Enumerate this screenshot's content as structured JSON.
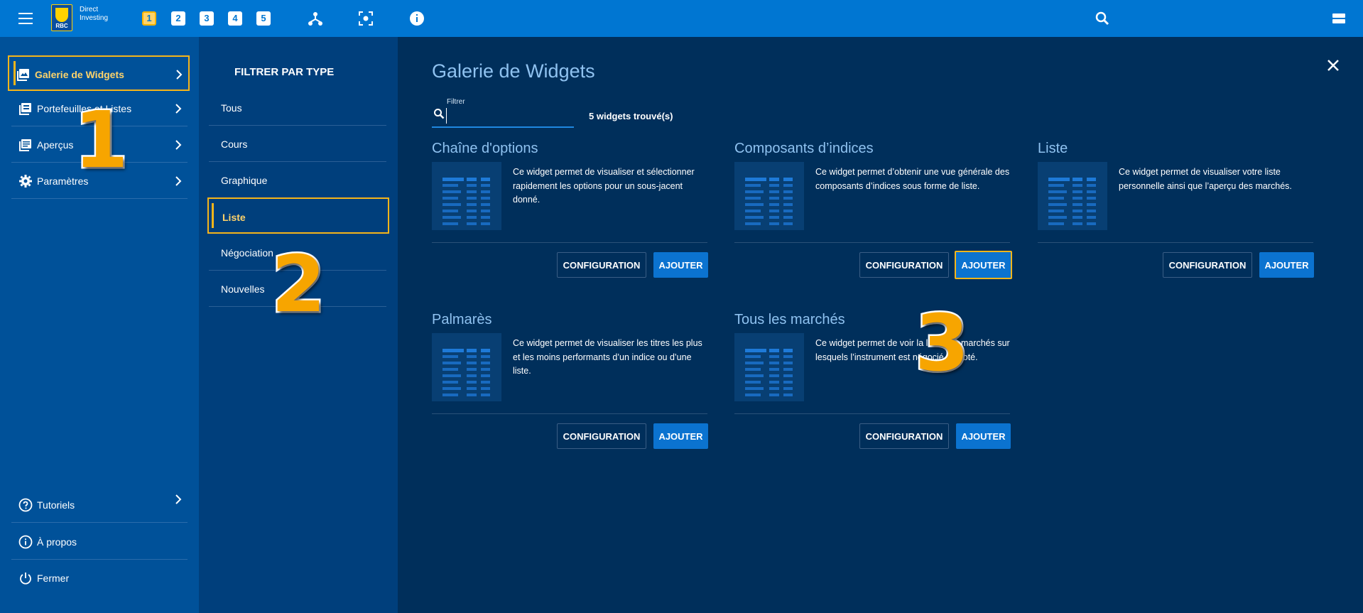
{
  "topbar": {
    "brand_line1": "Direct",
    "brand_line2": "Investing",
    "logo_text": "RBC",
    "workspaces": [
      "1",
      "2",
      "3",
      "4",
      "5"
    ],
    "active_workspace": "1"
  },
  "leftnav": {
    "items": [
      {
        "label": "Galerie de Widgets"
      },
      {
        "label": "Portefeuilles et Listes"
      },
      {
        "label": "Aperçus"
      },
      {
        "label": "Paramètres"
      }
    ],
    "bottom_items": [
      {
        "label": "Tutoriels"
      },
      {
        "label": "À propos"
      },
      {
        "label": "Fermer"
      }
    ]
  },
  "filter_panel": {
    "title": "FILTRER PAR TYPE",
    "items": [
      {
        "label": "Tous"
      },
      {
        "label": "Cours"
      },
      {
        "label": "Graphique"
      },
      {
        "label": "Liste"
      },
      {
        "label": "Négociation"
      },
      {
        "label": "Nouvelles"
      }
    ],
    "active": "Liste"
  },
  "main": {
    "title": "Galerie de Widgets",
    "search_label": "Filtrer",
    "search_value": "",
    "count": "5 widgets trouvé(s)",
    "config_label": "CONFIGURATION",
    "add_label": "AJOUTER",
    "widgets": [
      {
        "title": "Chaîne d'options",
        "desc": "Ce widget permet de visualiser et sélectionner rapidement les options pour un sous-jacent donné."
      },
      {
        "title": "Composants d’indices",
        "desc": "Ce widget permet d’obtenir une vue générale des composants d’indices sous forme de liste."
      },
      {
        "title": "Liste",
        "desc": "Ce widget permet de visualiser votre liste personnelle ainsi que l’aperçu des marchés."
      },
      {
        "title": "Palmarès",
        "desc": "Ce widget permet de visualiser les titres les plus et les moins performants d’un indice ou d’une liste."
      },
      {
        "title": "Tous les marchés",
        "desc": "Ce widget permet de voir la liste des marchés sur lesquels l’instrument est négocié ou coté."
      }
    ]
  },
  "annotations": [
    "1",
    "2",
    "3"
  ],
  "colors": {
    "topbar": "#0076d2",
    "leftnav": "#005199",
    "filter_panel": "#003f7c",
    "main": "#002f5b",
    "highlight": "#f5b51a",
    "accent_button": "#0b73d0"
  },
  "icons": {
    "topbar": [
      "menu-icon",
      "rbc-logo",
      "network-icon",
      "focus-icon",
      "info-icon",
      "search-icon",
      "layout-icon"
    ],
    "leftnav": [
      "gallery-icon",
      "portfolio-icon",
      "overview-icon",
      "gear-icon",
      "help-icon",
      "info-icon",
      "power-icon"
    ]
  }
}
